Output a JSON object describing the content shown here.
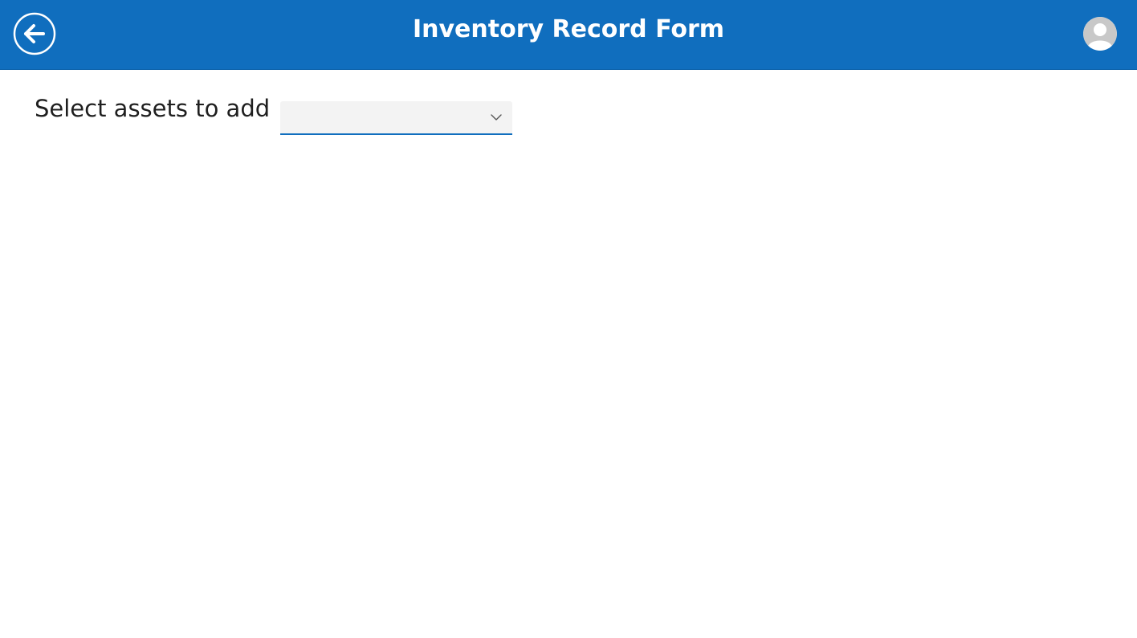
{
  "header": {
    "title": "Inventory Record Form",
    "background_color": "#106EBE",
    "back_icon": "arrow-left-circle-icon",
    "avatar_icon": "user-avatar-icon"
  },
  "form": {
    "assets_label": "Select assets to add",
    "assets_dropdown": {
      "selected_value": "",
      "icon": "chevron-down-icon",
      "accent_color": "#106EBE",
      "background_color": "#F3F3F3"
    }
  }
}
